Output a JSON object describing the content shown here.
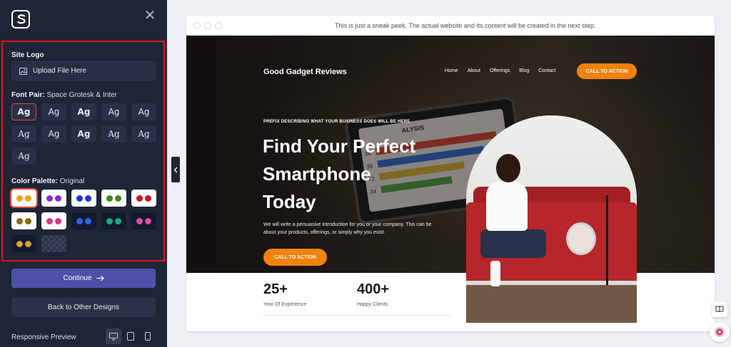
{
  "sidebar": {
    "site_logo_title": "Site Logo",
    "upload_label": "Upload File Here",
    "font_pair_title": "Font Pair:",
    "font_pair_value": "Space Grotesk & Inter",
    "font_sample": "Ag",
    "color_palette_title": "Color Palette:",
    "color_palette_value": "Original",
    "continue_label": "Continue",
    "back_label": "Back to Other Designs",
    "responsive_label": "Responsive Preview"
  },
  "palettes": [
    {
      "bg": "#ffffff",
      "c1": "#f2a31b",
      "c2": "#f2a31b",
      "selected": true
    },
    {
      "bg": "#ffffff",
      "c1": "#8d2bd6",
      "c2": "#8d2bd6"
    },
    {
      "bg": "#ffffff",
      "c1": "#1c35d6",
      "c2": "#1c35d6"
    },
    {
      "bg": "#ffffff",
      "c1": "#3d8a1b",
      "c2": "#3d8a1b"
    },
    {
      "bg": "#ffffff",
      "c1": "#c8151a",
      "c2": "#c8151a"
    },
    {
      "bg": "#ffffff",
      "c1": "#8a6a10",
      "c2": "#8a6a10"
    },
    {
      "bg": "#ffffff",
      "c1": "#d6348b",
      "c2": "#d6348b"
    },
    {
      "bg": "#121a2e",
      "c1": "#2b63e0",
      "c2": "#2b63e0"
    },
    {
      "bg": "#121a2e",
      "c1": "#1fa58d",
      "c2": "#1fa58d"
    },
    {
      "bg": "#121a2e",
      "c1": "#e04d9c",
      "c2": "#e04d9c"
    },
    {
      "bg": "#121a2e",
      "c1": "#d7a23a",
      "c2": "#d7a23a"
    }
  ],
  "preview": {
    "sneak_text": "This is just a sneak peek. The actual website and its content will be created in the next step.",
    "site_title": "Good Gadget Reviews",
    "nav": [
      "Home",
      "About",
      "Offerings",
      "Blog",
      "Contact"
    ],
    "cta_top": "CALL TO ACTION",
    "prefix": "PREFIX DESCRIBING WHAT YOUR BUSINESS DOES WILL BE HERE",
    "headline_1": "Find Your Perfect",
    "headline_2": "Smartphone",
    "headline_3": "Today",
    "intro": "We will write a persuasive introduction for you or your company. This can be about your products, offerings, or simply why you exist.",
    "cta_hero": "CALL TO ACTION",
    "stat1_num": "25+",
    "stat1_label": "Year Of Experience",
    "stat2_num": "400+",
    "stat2_label": "Happy Clients",
    "phone_text": "ALYSIS",
    "phone_nums": [
      "38",
      "36",
      "72",
      "34"
    ]
  },
  "colors": {
    "sidebar_bg": "#1e2536",
    "accent_orange": "#f2820c",
    "continue_bg": "#4d4fa8",
    "highlight_red": "#e0131a"
  }
}
